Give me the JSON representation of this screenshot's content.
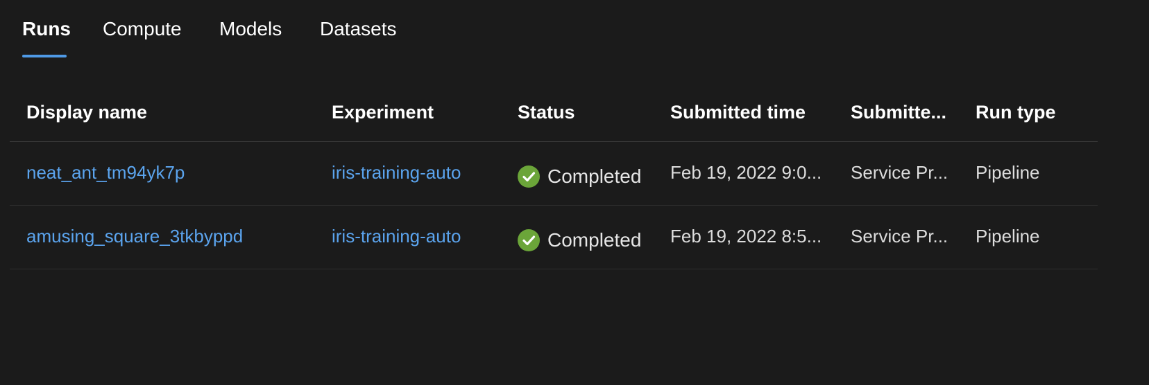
{
  "tabs": [
    {
      "label": "Runs",
      "active": true
    },
    {
      "label": "Compute",
      "active": false
    },
    {
      "label": "Models",
      "active": false
    },
    {
      "label": "Datasets",
      "active": false
    }
  ],
  "table": {
    "headers": [
      "Display name",
      "Experiment",
      "Status",
      "Submitted time",
      "Submitte...",
      "Run type"
    ],
    "rows": [
      {
        "display_name": "neat_ant_tm94yk7p",
        "experiment": "iris-training-auto",
        "status": "Completed",
        "submitted_time": "Feb 19, 2022 9:0...",
        "submitted_by": "Service Pr...",
        "run_type": "Pipeline"
      },
      {
        "display_name": "amusing_square_3tkbyppd",
        "experiment": "iris-training-auto",
        "status": "Completed",
        "submitted_time": "Feb 19, 2022 8:5...",
        "submitted_by": "Service Pr...",
        "run_type": "Pipeline"
      }
    ]
  },
  "colors": {
    "background": "#1b1b1b",
    "accent": "#4f9ae6",
    "link": "#5ba4ee",
    "success": "#6ba539"
  },
  "icons": {
    "status_completed": "check-circle-icon"
  }
}
